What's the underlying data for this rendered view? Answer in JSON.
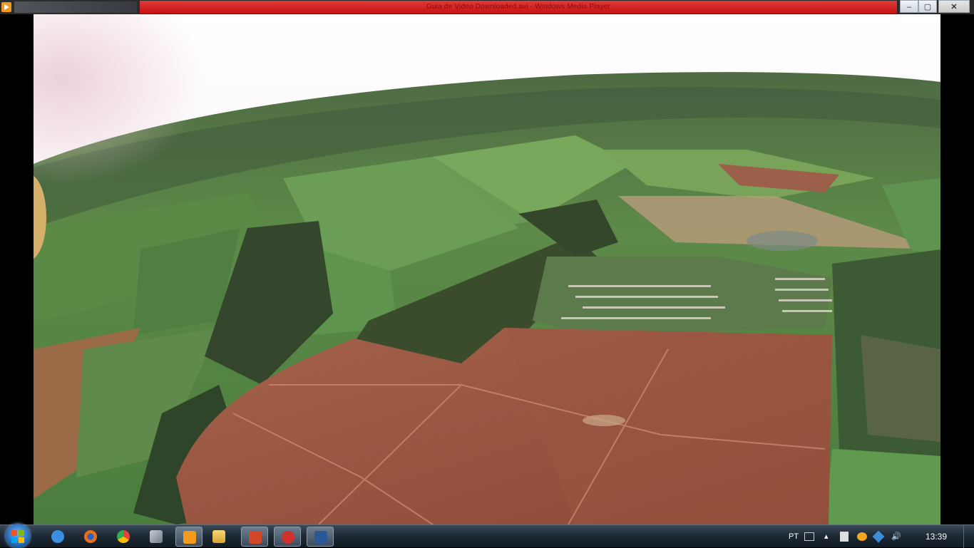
{
  "window": {
    "title": "Guia de Video Downloaded.avi - Windows Media Player",
    "controls": {
      "minimize": "–",
      "maximize": "▢",
      "close": "✕"
    }
  },
  "taskbar": {
    "pinned": [
      {
        "name": "internet-explorer-icon",
        "color": "#3a8fe0"
      },
      {
        "name": "firefox-icon",
        "color": "#e8701a"
      },
      {
        "name": "chrome-icon",
        "color": "#34a853"
      },
      {
        "name": "solidworks-explorer-icon",
        "color": "#9aa3ad"
      },
      {
        "name": "media-player-icon",
        "color": "#f29a1c"
      },
      {
        "name": "file-explorer-icon",
        "color": "#e3b341"
      },
      {
        "name": "powerpoint-icon",
        "color": "#d24726"
      },
      {
        "name": "solidworks-icon",
        "color": "#d0312d"
      },
      {
        "name": "word-icon",
        "color": "#2b5797"
      }
    ],
    "tray": {
      "language": "PT",
      "time": "13:39"
    }
  }
}
